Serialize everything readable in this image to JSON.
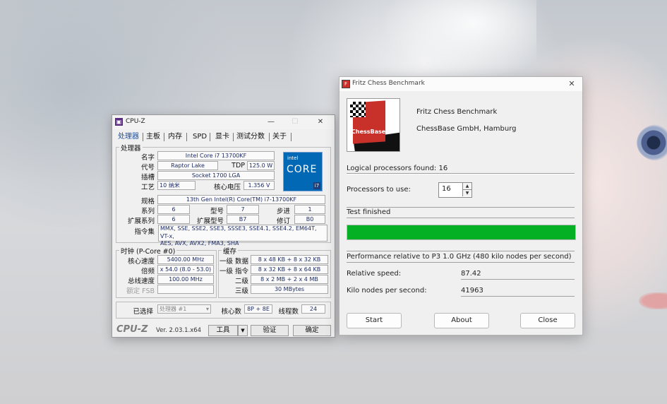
{
  "cpuz": {
    "title": "CPU-Z",
    "tabs": [
      "处理器",
      "主板",
      "内存",
      "SPD",
      "显卡",
      "测试分数",
      "关于"
    ],
    "processor_group": "处理器",
    "name_label": "名字",
    "name": "Intel Core i7 13700KF",
    "codename_label": "代号",
    "codename": "Raptor Lake",
    "tdp_label": "TDP",
    "tdp": "125.0 W",
    "package_label": "插槽",
    "package": "Socket 1700 LGA",
    "tech_label": "工艺",
    "tech": "10 纳米",
    "voltage_label": "核心电压",
    "voltage": "1.356 V",
    "spec_label": "规格",
    "spec": "13th Gen Intel(R) Core(TM) i7-13700KF",
    "family_label": "系列",
    "family": "6",
    "model_label": "型号",
    "model": "7",
    "stepping_label": "步进",
    "stepping": "1",
    "extfamily_label": "扩展系列",
    "extfamily": "6",
    "extmodel_label": "扩展型号",
    "extmodel": "B7",
    "revision_label": "修订",
    "revision": "B0",
    "instr_label": "指令集",
    "instr_line1": "MMX, SSE, SSE2, SSE3, SSSE3, SSE4.1, SSE4.2, EM64T, VT-x,",
    "instr_line2": "AES, AVX, AVX2, FMA3, SHA",
    "intel_badge": {
      "brand": "intel",
      "line": "CORE",
      "tier": "i7"
    },
    "clocks_group": "时钟 (P-Core #0)",
    "core_speed_label": "核心速度",
    "core_speed": "5400.00 MHz",
    "multiplier_label": "倍频",
    "multiplier": "x 54.0 (8.0 - 53.0)",
    "bus_speed_label": "总线速度",
    "bus_speed": "100.00 MHz",
    "rated_fsb_label": "额定 FSB",
    "rated_fsb": "",
    "cache_group": "缓存",
    "l1d_label": "一级 数据",
    "l1d": "8 x 48 KB + 8 x 32 KB",
    "l1i_label": "一级 指令",
    "l1i": "8 x 32 KB + 8 x 64 KB",
    "l2_label": "二级",
    "l2": "8 x 2 MB + 2 x 4 MB",
    "l3_label": "三级",
    "l3": "30 MBytes",
    "selection_label": "已选择",
    "selection": "处理器 #1",
    "cores_label": "核心数",
    "cores": "8P + 8E",
    "threads_label": "线程数",
    "threads": "24",
    "logo": "CPU-Z",
    "version": "Ver. 2.03.1.x64",
    "tools_button": "工具",
    "validate_button": "验证",
    "ok_button": "确定"
  },
  "fritz": {
    "title": "Fritz Chess Benchmark",
    "logo_text": "ChessBase",
    "app_name": "Fritz Chess Benchmark",
    "company": "ChessBase GmbH, Hamburg",
    "logical_processors": "Logical processors found: 16",
    "processors_label": "Processors to use:",
    "processors_value": "16",
    "status": "Test finished",
    "progress": 1.0,
    "progress_color": "#06b025",
    "perf_header": "Performance relative to P3 1.0 GHz (480 kilo nodes per second)",
    "relative_speed_label": "Relative speed:",
    "relative_speed": "87.42",
    "knps_label": "Kilo nodes per second:",
    "knps": "41963",
    "start_button": "Start",
    "about_button": "About",
    "close_button": "Close"
  }
}
